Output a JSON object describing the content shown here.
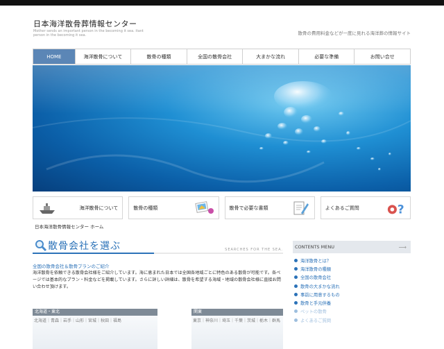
{
  "header": {
    "title": "日本海洋散骨葬情報センター",
    "tagline": "Mother sends an important person in the becoming it sea. itant person in the becoming it sea.",
    "description": "散骨の費用料金などが一度に見れる海洋葬の情報サイト"
  },
  "nav": {
    "items": [
      "HOME",
      "海洋散骨について",
      "散骨の種類",
      "全国の散骨会社",
      "大まかな流れ",
      "必要な準備",
      "お問い合せ"
    ]
  },
  "features": [
    {
      "label": "海洋散骨について",
      "icon": "ship-icon"
    },
    {
      "label": "散骨の種類",
      "icon": "photos-icon"
    },
    {
      "label": "散骨で必要な書類",
      "icon": "document-pen-icon"
    },
    {
      "label": "よくあるご質問",
      "icon": "question-icon"
    }
  ],
  "breadcrumb": "日本海洋散骨情報センター ホーム",
  "section": {
    "title": "散骨会社を選ぶ",
    "subtitle_en": "SEARCHES FOR THE SEA."
  },
  "intro": {
    "heading": "全国の散骨会社＆散骨プランのご紹介",
    "text": "海洋散骨を依頼できる散骨会社様をご紹介しています。海に恵まれた日本では全国各地域ごとに特色のある散骨が可能です。各ページでは基本的なプラン・料金などを掲載しています。さらに詳しい詳細は、散骨を希望する海域・地域の散骨会社様に直接お問い合わせ頂けます。"
  },
  "regions": [
    {
      "name": "北海道・東北",
      "areas": "北海道｜青森｜岩手｜山形｜宮城｜秋田｜福島"
    },
    {
      "name": "関東",
      "areas": "東京｜神奈川｜埼玉｜千葉｜茨城｜栃木｜群馬"
    }
  ],
  "sidebar": {
    "title": "CONTENTS MENU",
    "items": [
      "海洋散骨とは？",
      "海洋散骨の種類",
      "全国の散骨会社",
      "散骨の大まかな流れ",
      "事前に用意するもの",
      "散骨と手元供養",
      "ペットの散骨",
      "よくあるご質問"
    ]
  },
  "colors": {
    "accent": "#2b72b8",
    "nav_active": "#5b86b6",
    "topbar": "#111111"
  }
}
